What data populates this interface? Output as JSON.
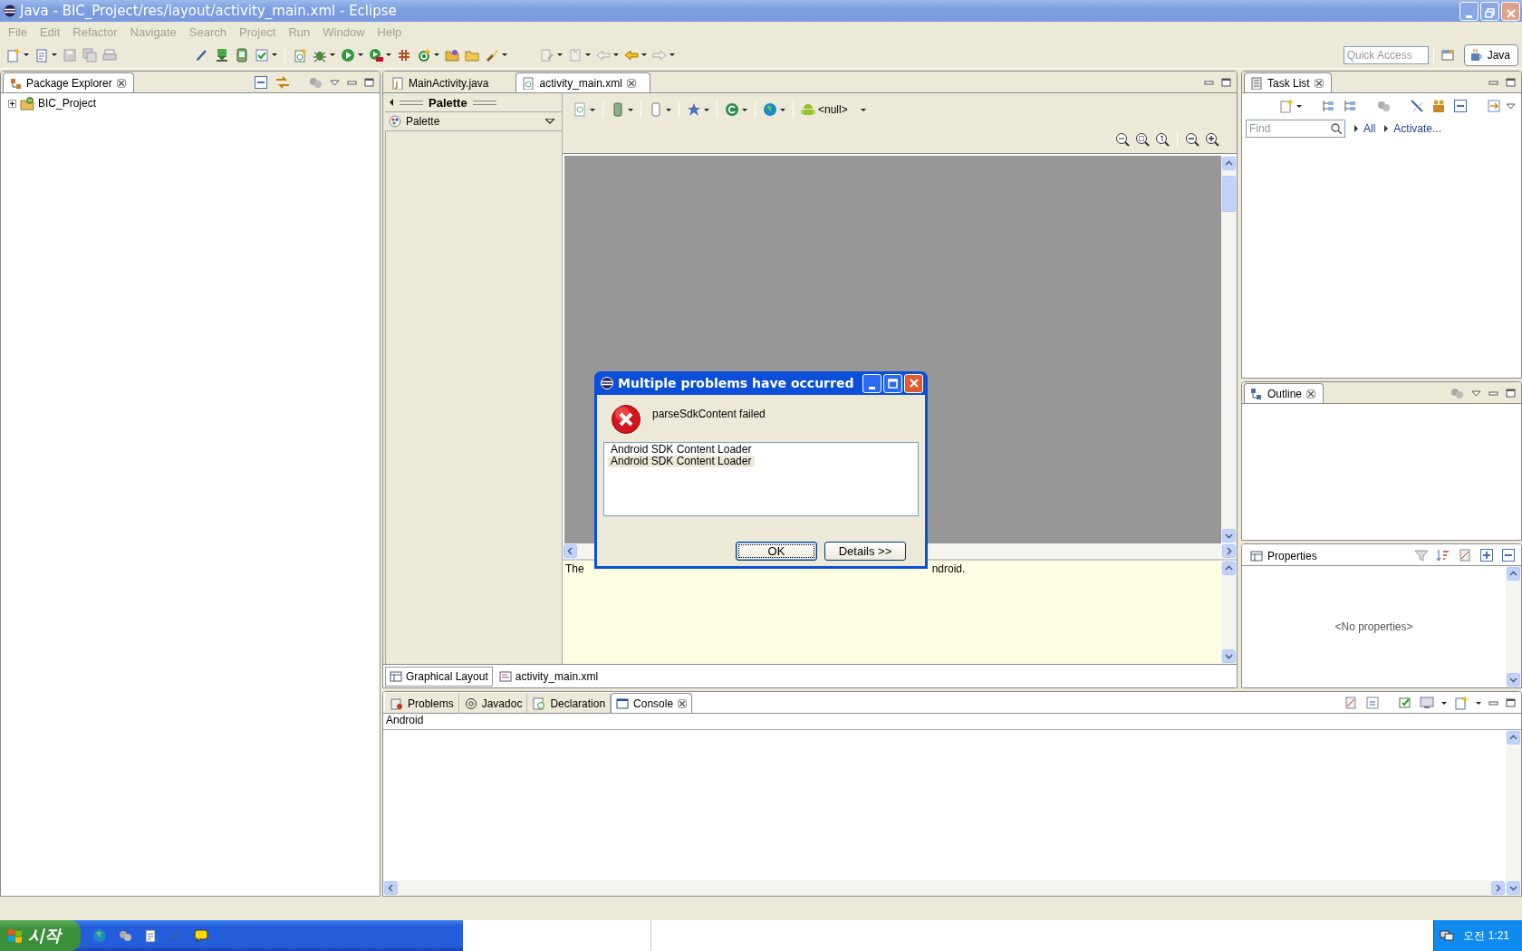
{
  "window": {
    "title": "Java - BIC_Project/res/layout/activity_main.xml - Eclipse"
  },
  "menu": [
    "File",
    "Edit",
    "Refactor",
    "Navigate",
    "Search",
    "Project",
    "Run",
    "Window",
    "Help"
  ],
  "quick_access": {
    "placeholder": "Quick Access"
  },
  "perspective": {
    "label": "Java",
    "selected": true
  },
  "package_explorer": {
    "tab": "Package Explorer",
    "tree": [
      {
        "label": "BIC_Project",
        "expanded": false
      }
    ]
  },
  "editor": {
    "tabs": [
      {
        "label": "MainActivity.java",
        "selected": false
      },
      {
        "label": "activity_main.xml",
        "selected": true
      }
    ],
    "palette": {
      "header": "Palette",
      "dropdown": "Palette"
    },
    "theme_label": "<null>",
    "message_parts": [
      "The",
      "ndroid."
    ],
    "bottom_tabs": [
      {
        "label": "Graphical Layout",
        "selected": true
      },
      {
        "label": "activity_main.xml",
        "selected": false
      }
    ]
  },
  "task_list": {
    "tab": "Task List",
    "find": {
      "placeholder": "Find"
    },
    "links": [
      "All",
      "Activate..."
    ]
  },
  "outline": {
    "tab": "Outline"
  },
  "properties": {
    "tab": "Properties",
    "empty": "<No properties>"
  },
  "console": {
    "tabs": [
      {
        "label": "Problems",
        "selected": false
      },
      {
        "label": "Javadoc",
        "selected": false
      },
      {
        "label": "Declaration",
        "selected": false
      },
      {
        "label": "Console",
        "selected": true
      }
    ],
    "title": "Android"
  },
  "dialog": {
    "title": "Multiple problems have occurred",
    "message": "parseSdkContent failed",
    "items": [
      {
        "label": "Android SDK Content Loader",
        "selected": false
      },
      {
        "label": "Android SDK Content Loader",
        "selected": true
      }
    ],
    "buttons": [
      {
        "label": "OK",
        "default": true
      },
      {
        "label": "Details >>",
        "default": false
      }
    ]
  },
  "taskbar": {
    "start": "시작",
    "clock": "오전 1:21"
  }
}
